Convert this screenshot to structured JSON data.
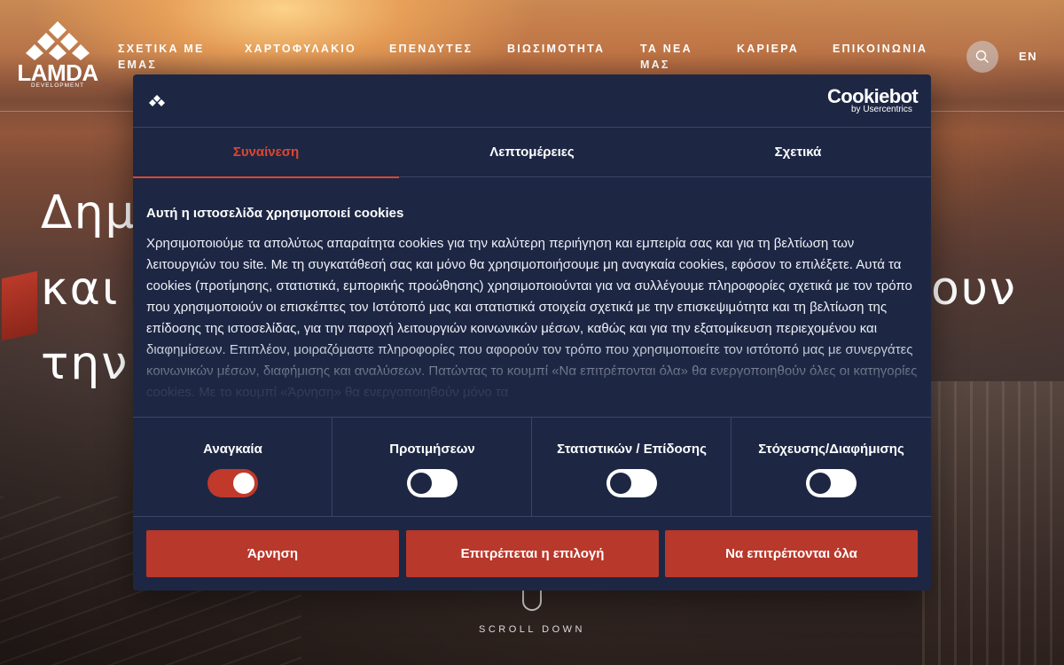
{
  "header": {
    "logo_word": "LAMDA",
    "logo_sub": "DEVELOPMENT",
    "nav": [
      {
        "line1": "ΣΧΕΤΙΚΑ ΜΕ",
        "line2": "ΕΜΑΣ"
      },
      {
        "line1": "ΧΑΡΤΟΦΥΛΑΚΙΟ",
        "line2": ""
      },
      {
        "line1": "ΕΠΕΝΔΥΤΕΣ",
        "line2": ""
      },
      {
        "line1": "ΒΙΩΣΙΜΟΤΗΤΑ",
        "line2": ""
      },
      {
        "line1": "ΤΑ ΝΕΑ",
        "line2": "ΜΑΣ"
      },
      {
        "line1": "ΚΑΡΙΕΡΑ",
        "line2": ""
      },
      {
        "line1": "ΕΠΙΚΟΙΝΩΝΙΑ",
        "line2": ""
      }
    ],
    "lang": "EN",
    "search_icon": "search-icon"
  },
  "hero": {
    "line1": "Δημ",
    "line2": "και",
    "line2_right": "ουν",
    "line3": "την",
    "scroll_label": "SCROLL DOWN"
  },
  "cookie": {
    "brand": "Cookiebot",
    "brand_sub": "by Usercentrics",
    "tabs": [
      "Συναίνεση",
      "Λεπτομέρειες",
      "Σχετικά"
    ],
    "title": "Αυτή η ιστοσελίδα χρησιμοποιεί cookies",
    "text": "Χρησιμοποιούμε τα απολύτως απαραίτητα cookies για την καλύτερη περιήγηση και εμπειρία σας και για τη βελτίωση των λειτουργιών του site. Με τη συγκατάθεσή σας και μόνο θα χρησιμοποιήσουμε μη αναγκαία cookies, εφόσον το επιλέξετε. Αυτά τα cookies (προτίμησης, στατιστικά, εμπορικής προώθησης) χρησιμοποιούνται για να συλλέγουμε πληροφορίες σχετικά με τον τρόπο που χρησιμοποιούν οι επισκέπτες τον Ιστότοπό μας και στατιστικά στοιχεία σχετικά με την επισκεψιμότητα και τη βελτίωση της επίδοσης της ιστοσελίδας, για την παροχή λειτουργιών κοινωνικών μέσων, καθώς και για την εξατομίκευση περιεχομένου και διαφημίσεων. Επιπλέον, μοιραζόμαστε πληροφορίες που αφορούν τον τρόπο που χρησιμοποιείτε τον ιστότοπό μας με συνεργάτες κοινωνικών μέσων, διαφήμισης και αναλύσεων. Πατώντας το κουμπί «Να επιτρέπονται όλα» θα ενεργοποιηθούν όλες οι κατηγορίες cookies. Με το κουμπί «Άρνηση» θα ενεργοποιηθούν μόνο τα",
    "toggles": [
      {
        "label": "Αναγκαία",
        "on": true
      },
      {
        "label": "Προτιμήσεων",
        "on": false
      },
      {
        "label": "Στατιστικών / Επίδοσης",
        "on": false
      },
      {
        "label": "Στόχευσης/Διαφήμισης",
        "on": false
      }
    ],
    "buttons": {
      "deny": "Άρνηση",
      "allow_selection": "Επιτρέπεται η επιλογή",
      "allow_all": "Να επιτρέπονται όλα"
    },
    "colors": {
      "panel": "#1d2744",
      "accent": "#e2442f",
      "button": "#b8382c"
    }
  }
}
